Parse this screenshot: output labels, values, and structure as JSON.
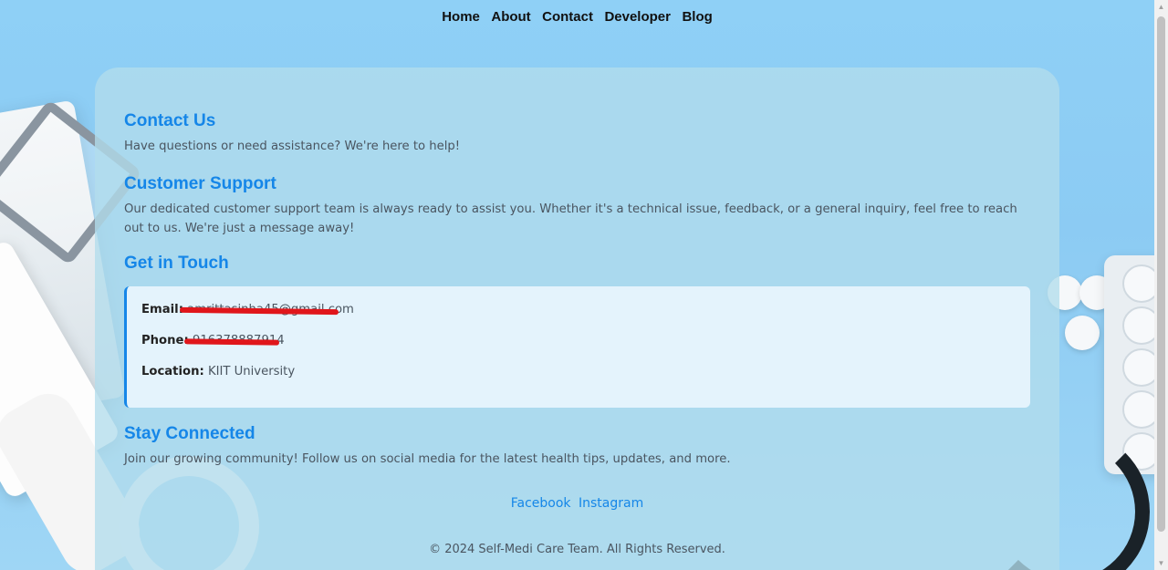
{
  "nav": {
    "items": [
      "Home",
      "About",
      "Contact",
      "Developer",
      "Blog"
    ]
  },
  "contact": {
    "title": "Contact Us",
    "text": "Have questions or need assistance? We're here to help!"
  },
  "support": {
    "title": "Customer Support",
    "text": "Our dedicated customer support team is always ready to assist you. Whether it's a technical issue, feedback, or a general inquiry, feel free to reach out to us. We're just a message away!"
  },
  "touch": {
    "title": "Get in Touch",
    "email_label": "Email:",
    "email_value": "amrittasinha45@gmail.com",
    "phone_label": "Phone:",
    "phone_value": "916378887914",
    "location_label": "Location:",
    "location_value": "KIIT University"
  },
  "stay": {
    "title": "Stay Connected",
    "text": "Join our growing community! Follow us on social media for the latest health tips, updates, and more."
  },
  "social": {
    "facebook": "Facebook",
    "instagram": "Instagram"
  },
  "footer": {
    "text": "© 2024 Self-Medi Care Team. All Rights Reserved."
  },
  "colors": {
    "accent": "#1586e8",
    "redaction": "#e0161b",
    "background": "#8fd0f6"
  }
}
